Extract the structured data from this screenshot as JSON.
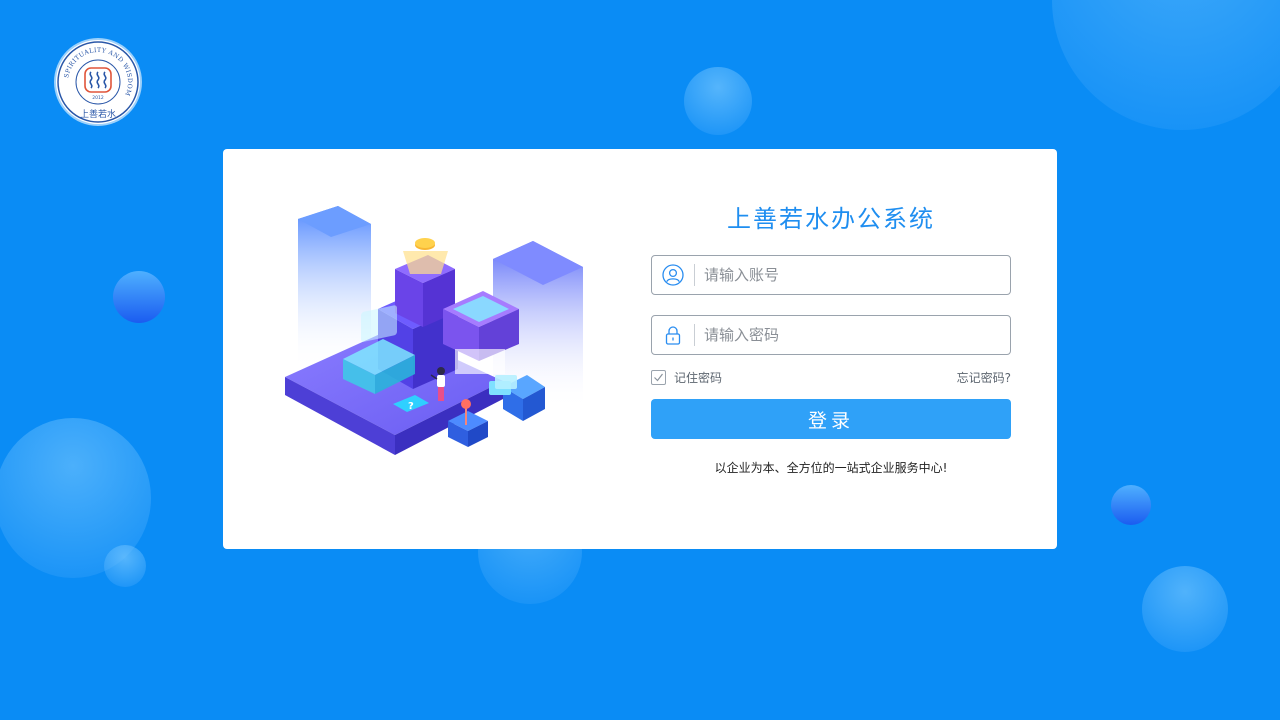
{
  "logo": {
    "ring_text": "SPIRITUALITY AND WISDOM",
    "bottom_text": "上善若水",
    "year": "2012"
  },
  "login": {
    "title": "上善若水办公系统",
    "account_placeholder": "请输入账号",
    "password_placeholder": "请输入密码",
    "remember_label": "记住密码",
    "remember_checked": true,
    "forgot_label": "忘记密码?",
    "submit_label": "登录",
    "slogan": "以企业为本、全方位的一站式企业服务中心!"
  },
  "icons": {
    "account": "user-icon",
    "password": "lock-icon",
    "checkbox": "check-icon"
  },
  "colors": {
    "background": "#0a8cf5",
    "accent": "#1f8ef0",
    "button": "#2fa1f8",
    "card": "#ffffff"
  }
}
